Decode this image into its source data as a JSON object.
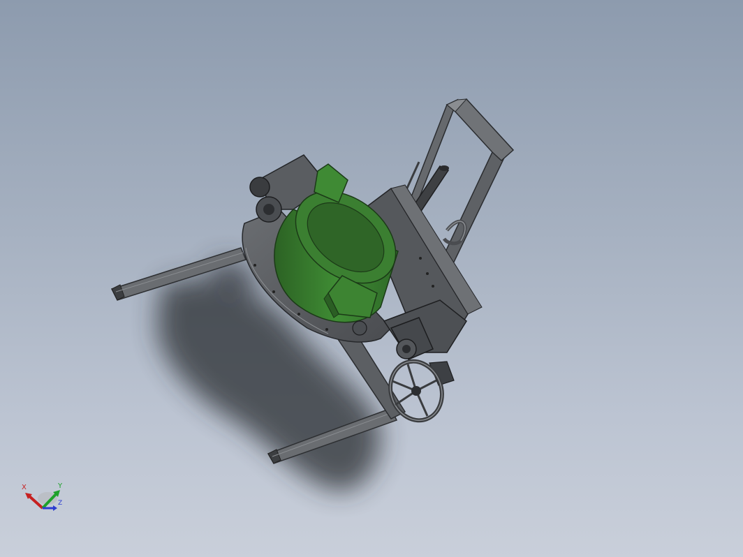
{
  "viewport": {
    "background_top": "#8d9bae",
    "background_bottom": "#c9cfda"
  },
  "model": {
    "description_icon": "3d-assembly-icon",
    "accent_color": "#3d7a32",
    "frame_color": "#5f6266"
  },
  "triad": {
    "x_label": "X",
    "y_label": "Y",
    "z_label": "Z",
    "x_color": "#c62020",
    "y_color": "#1ea12b",
    "z_color": "#2b3bd0"
  }
}
